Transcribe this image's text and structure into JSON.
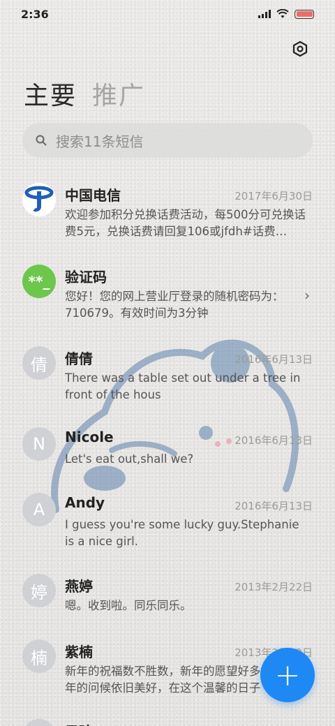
{
  "status_bar": {
    "time": "2:36"
  },
  "tabs": [
    {
      "label": "主要",
      "active": true
    },
    {
      "label": "推广",
      "active": false
    }
  ],
  "search": {
    "placeholder": "搜索11条短信"
  },
  "conversations": [
    {
      "name": "中国电信",
      "date": "2017年6月30日",
      "preview": "欢迎参加积分兑换话费活动，每500分可兑换话费5元，兑换话费请回复106或jfdh#话费…",
      "avatar_text": "",
      "avatar_icon": "china-telecom-logo"
    },
    {
      "name": "验证码",
      "date": "",
      "preview": "您好！您的网上营业厅登录的随机密码为：710679。有效时间为3分钟",
      "avatar_text": "**_",
      "avatar_color": "#6cc74c"
    },
    {
      "name": "倩倩",
      "date": "2016年6月13日",
      "preview": "There was a table set out under a tree in front of the hous",
      "avatar_text": "倩"
    },
    {
      "name": "Nicole",
      "date": "2016年6月13日",
      "preview": "Let's eat out,shall we?",
      "avatar_text": "N"
    },
    {
      "name": "Andy",
      "date": "2016年6月13日",
      "preview": "I guess you're some lucky guy.Stephanie is a nice girl.",
      "avatar_text": "A"
    },
    {
      "name": "燕婷",
      "date": "2013年2月22日",
      "preview": "嗯。收到啦。同乐同乐。",
      "avatar_text": "婷"
    },
    {
      "name": "紫楠",
      "date": "2013年2月22日",
      "preview": "新年的祝福数不胜数，新年的愿望好多好多，新年的问候依旧美好，在这个温馨的日子",
      "avatar_text": "楠"
    },
    {
      "name": "子玲",
      "date": "",
      "preview": "",
      "avatar_text": ""
    }
  ],
  "fab": {
    "label": "+"
  },
  "colors": {
    "accent": "#1e88f5",
    "verify_avatar": "#6cc74c",
    "avatar_gray": "#cfd1d4"
  }
}
